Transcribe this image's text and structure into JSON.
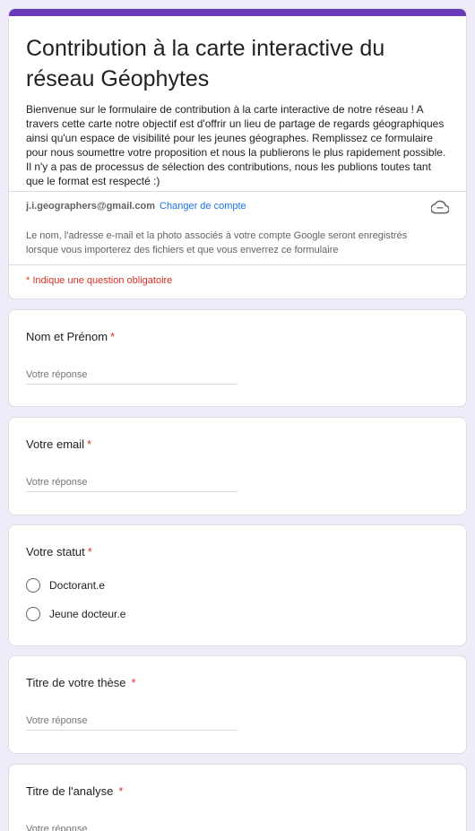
{
  "header": {
    "title": "Contribution à la carte interactive du réseau Géophytes",
    "description": "Bienvenue sur le formulaire de contribution à la carte interactive de notre réseau ! A travers cette carte notre objectif est d'offrir un lieu de partage de regards géographiques ainsi qu'un espace de visibilité pour les jeunes géographes. Remplissez ce formulaire pour nous soumettre votre proposition et nous la publierons le plus rapidement possible. Il n'y a pas de processus de sélection des contributions, nous les publions toutes tant que le format est respecté :)",
    "account_email": "j.i.geographers@gmail.com",
    "switch_account_label": "Changer de compte",
    "cloud_icon": "cloud-not-saved-icon",
    "account_note": "Le nom, l'adresse e-mail et la photo associés à votre compte Google seront enregistrés lorsque vous importerez des fichiers et que vous enverrez ce formulaire",
    "required_note": "* Indique une question obligatoire"
  },
  "questions": {
    "name": {
      "title": "Nom et Prénom",
      "required_mark": "*",
      "placeholder": "Votre réponse"
    },
    "email": {
      "title": "Votre email",
      "required_mark": "*",
      "placeholder": "Votre réponse"
    },
    "status": {
      "title": "Votre statut",
      "required_mark": "*",
      "options": [
        "Doctorant.e",
        "Jeune docteur.e"
      ]
    },
    "thesis": {
      "title": "Titre de votre thèse",
      "required_mark": "*",
      "placeholder": "Votre réponse"
    },
    "analysis": {
      "title": "Titre de l'analyse",
      "required_mark": "*",
      "placeholder": "Votre réponse"
    }
  },
  "colors": {
    "accent": "#673ab7",
    "background": "#f0ebf8",
    "required": "#d93025",
    "link": "#1a73e8"
  }
}
